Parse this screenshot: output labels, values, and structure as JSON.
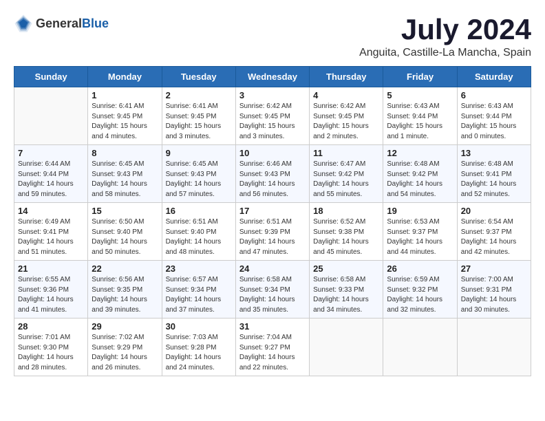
{
  "header": {
    "logo_general": "General",
    "logo_blue": "Blue",
    "month_title": "July 2024",
    "location": "Anguita, Castille-La Mancha, Spain"
  },
  "days_of_week": [
    "Sunday",
    "Monday",
    "Tuesday",
    "Wednesday",
    "Thursday",
    "Friday",
    "Saturday"
  ],
  "weeks": [
    [
      {
        "day": "",
        "sunrise": "",
        "sunset": "",
        "daylight": ""
      },
      {
        "day": "1",
        "sunrise": "Sunrise: 6:41 AM",
        "sunset": "Sunset: 9:45 PM",
        "daylight": "Daylight: 15 hours and 4 minutes."
      },
      {
        "day": "2",
        "sunrise": "Sunrise: 6:41 AM",
        "sunset": "Sunset: 9:45 PM",
        "daylight": "Daylight: 15 hours and 3 minutes."
      },
      {
        "day": "3",
        "sunrise": "Sunrise: 6:42 AM",
        "sunset": "Sunset: 9:45 PM",
        "daylight": "Daylight: 15 hours and 3 minutes."
      },
      {
        "day": "4",
        "sunrise": "Sunrise: 6:42 AM",
        "sunset": "Sunset: 9:45 PM",
        "daylight": "Daylight: 15 hours and 2 minutes."
      },
      {
        "day": "5",
        "sunrise": "Sunrise: 6:43 AM",
        "sunset": "Sunset: 9:44 PM",
        "daylight": "Daylight: 15 hours and 1 minute."
      },
      {
        "day": "6",
        "sunrise": "Sunrise: 6:43 AM",
        "sunset": "Sunset: 9:44 PM",
        "daylight": "Daylight: 15 hours and 0 minutes."
      }
    ],
    [
      {
        "day": "7",
        "sunrise": "Sunrise: 6:44 AM",
        "sunset": "Sunset: 9:44 PM",
        "daylight": "Daylight: 14 hours and 59 minutes."
      },
      {
        "day": "8",
        "sunrise": "Sunrise: 6:45 AM",
        "sunset": "Sunset: 9:43 PM",
        "daylight": "Daylight: 14 hours and 58 minutes."
      },
      {
        "day": "9",
        "sunrise": "Sunrise: 6:45 AM",
        "sunset": "Sunset: 9:43 PM",
        "daylight": "Daylight: 14 hours and 57 minutes."
      },
      {
        "day": "10",
        "sunrise": "Sunrise: 6:46 AM",
        "sunset": "Sunset: 9:43 PM",
        "daylight": "Daylight: 14 hours and 56 minutes."
      },
      {
        "day": "11",
        "sunrise": "Sunrise: 6:47 AM",
        "sunset": "Sunset: 9:42 PM",
        "daylight": "Daylight: 14 hours and 55 minutes."
      },
      {
        "day": "12",
        "sunrise": "Sunrise: 6:48 AM",
        "sunset": "Sunset: 9:42 PM",
        "daylight": "Daylight: 14 hours and 54 minutes."
      },
      {
        "day": "13",
        "sunrise": "Sunrise: 6:48 AM",
        "sunset": "Sunset: 9:41 PM",
        "daylight": "Daylight: 14 hours and 52 minutes."
      }
    ],
    [
      {
        "day": "14",
        "sunrise": "Sunrise: 6:49 AM",
        "sunset": "Sunset: 9:41 PM",
        "daylight": "Daylight: 14 hours and 51 minutes."
      },
      {
        "day": "15",
        "sunrise": "Sunrise: 6:50 AM",
        "sunset": "Sunset: 9:40 PM",
        "daylight": "Daylight: 14 hours and 50 minutes."
      },
      {
        "day": "16",
        "sunrise": "Sunrise: 6:51 AM",
        "sunset": "Sunset: 9:40 PM",
        "daylight": "Daylight: 14 hours and 48 minutes."
      },
      {
        "day": "17",
        "sunrise": "Sunrise: 6:51 AM",
        "sunset": "Sunset: 9:39 PM",
        "daylight": "Daylight: 14 hours and 47 minutes."
      },
      {
        "day": "18",
        "sunrise": "Sunrise: 6:52 AM",
        "sunset": "Sunset: 9:38 PM",
        "daylight": "Daylight: 14 hours and 45 minutes."
      },
      {
        "day": "19",
        "sunrise": "Sunrise: 6:53 AM",
        "sunset": "Sunset: 9:37 PM",
        "daylight": "Daylight: 14 hours and 44 minutes."
      },
      {
        "day": "20",
        "sunrise": "Sunrise: 6:54 AM",
        "sunset": "Sunset: 9:37 PM",
        "daylight": "Daylight: 14 hours and 42 minutes."
      }
    ],
    [
      {
        "day": "21",
        "sunrise": "Sunrise: 6:55 AM",
        "sunset": "Sunset: 9:36 PM",
        "daylight": "Daylight: 14 hours and 41 minutes."
      },
      {
        "day": "22",
        "sunrise": "Sunrise: 6:56 AM",
        "sunset": "Sunset: 9:35 PM",
        "daylight": "Daylight: 14 hours and 39 minutes."
      },
      {
        "day": "23",
        "sunrise": "Sunrise: 6:57 AM",
        "sunset": "Sunset: 9:34 PM",
        "daylight": "Daylight: 14 hours and 37 minutes."
      },
      {
        "day": "24",
        "sunrise": "Sunrise: 6:58 AM",
        "sunset": "Sunset: 9:34 PM",
        "daylight": "Daylight: 14 hours and 35 minutes."
      },
      {
        "day": "25",
        "sunrise": "Sunrise: 6:58 AM",
        "sunset": "Sunset: 9:33 PM",
        "daylight": "Daylight: 14 hours and 34 minutes."
      },
      {
        "day": "26",
        "sunrise": "Sunrise: 6:59 AM",
        "sunset": "Sunset: 9:32 PM",
        "daylight": "Daylight: 14 hours and 32 minutes."
      },
      {
        "day": "27",
        "sunrise": "Sunrise: 7:00 AM",
        "sunset": "Sunset: 9:31 PM",
        "daylight": "Daylight: 14 hours and 30 minutes."
      }
    ],
    [
      {
        "day": "28",
        "sunrise": "Sunrise: 7:01 AM",
        "sunset": "Sunset: 9:30 PM",
        "daylight": "Daylight: 14 hours and 28 minutes."
      },
      {
        "day": "29",
        "sunrise": "Sunrise: 7:02 AM",
        "sunset": "Sunset: 9:29 PM",
        "daylight": "Daylight: 14 hours and 26 minutes."
      },
      {
        "day": "30",
        "sunrise": "Sunrise: 7:03 AM",
        "sunset": "Sunset: 9:28 PM",
        "daylight": "Daylight: 14 hours and 24 minutes."
      },
      {
        "day": "31",
        "sunrise": "Sunrise: 7:04 AM",
        "sunset": "Sunset: 9:27 PM",
        "daylight": "Daylight: 14 hours and 22 minutes."
      },
      {
        "day": "",
        "sunrise": "",
        "sunset": "",
        "daylight": ""
      },
      {
        "day": "",
        "sunrise": "",
        "sunset": "",
        "daylight": ""
      },
      {
        "day": "",
        "sunrise": "",
        "sunset": "",
        "daylight": ""
      }
    ]
  ]
}
